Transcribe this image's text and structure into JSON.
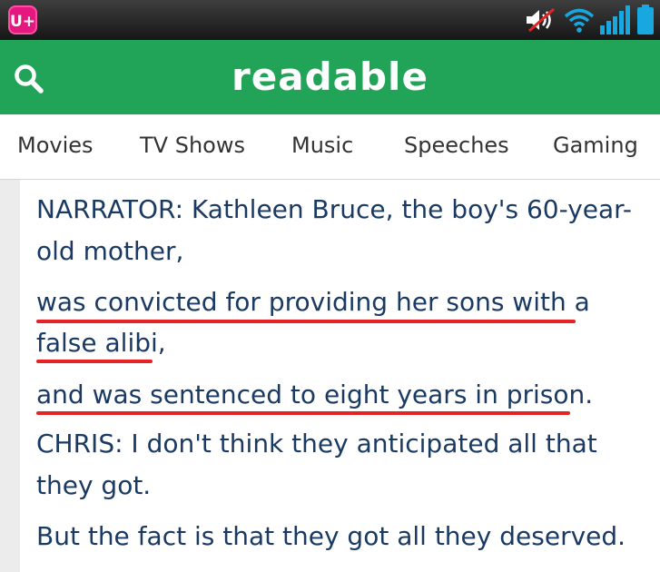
{
  "status_bar": {
    "carrier_logo": "U+",
    "icons": [
      "mute-speaker-icon",
      "wifi-icon",
      "signal-bars-icon",
      "battery-icon"
    ],
    "colors": {
      "background": "#1e1e1e",
      "icons": "#19a7e0",
      "logo": "#e5187f"
    }
  },
  "header": {
    "brand": "readable",
    "search_icon": "search-icon",
    "colors": {
      "background": "#22a458",
      "text": "#ffffff"
    }
  },
  "nav": {
    "items": [
      "Movies",
      "TV Shows",
      "Music",
      "Speeches",
      "Gaming"
    ]
  },
  "transcript": {
    "lines": [
      "NARRATOR: Kathleen Bruce, the boy's 60-year-",
      "old mother,",
      "was convicted for providing her sons with a",
      "false alibi,",
      "and was sentenced to eight years in prison.",
      "CHRIS: I don't think they anticipated all that",
      "they got.",
      "But the fact is that they got all they deserved."
    ],
    "highlight_color": "#e52325",
    "text_color": "#1a3a63"
  }
}
